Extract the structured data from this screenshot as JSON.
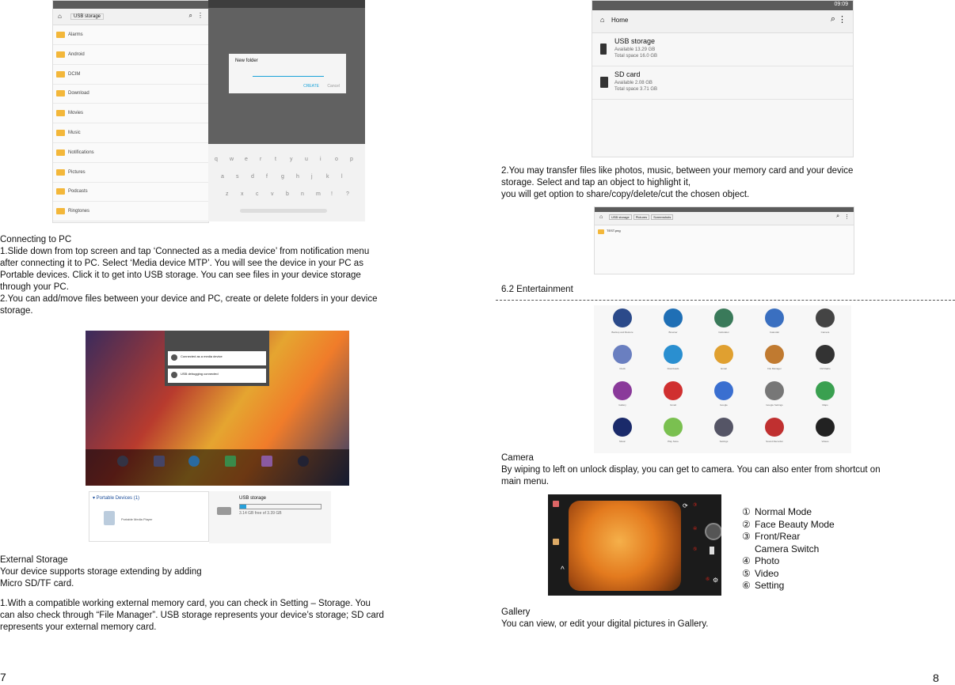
{
  "left": {
    "connecting_title": "Connecting to PC",
    "connecting_body": "1.Slide down from top screen and tap ‘Connected as a media device’ from notification menu\nafter connecting it to PC. Select ‘Media device MTP’. You will see the device in your PC as\nPortable devices. Click it to get into USB storage. You can see files in your device storage\nthrough your PC.\n2.You can add/move files between your device and PC, create or delete folders in your device\nstorage.",
    "external_title": "External Storage",
    "external_body": "Your device supports storage extending by adding\nMicro SD/TF card.",
    "external_body2": "1.With a compatible working external memory card, you can check in Setting – Storage. You\ncan also check through “File Manager”. USB storage represents your device’s storage; SD card\nrepresents your external memory card.",
    "page_number": "7",
    "filemgr": {
      "breadcrumb": "USB storage",
      "folders": [
        "Alarms",
        "Android",
        "DCIM",
        "Download",
        "Movies",
        "Music",
        "Notifications",
        "Pictures",
        "Podcasts",
        "Ringtones"
      ]
    },
    "dialog": {
      "title": "New folder",
      "create": "CREATE",
      "cancel": "Cancel",
      "keys_row1": [
        "q",
        "w",
        "e",
        "r",
        "t",
        "y",
        "u",
        "i",
        "o",
        "p"
      ],
      "keys_row2": [
        "a",
        "s",
        "d",
        "f",
        "g",
        "h",
        "j",
        "k",
        "l"
      ],
      "keys_row3": [
        "z",
        "x",
        "c",
        "v",
        "b",
        "n",
        "m",
        "!",
        "?"
      ]
    },
    "notify": {
      "item1": "Connected as a media device",
      "item2": "USB debugging connected"
    },
    "pc": {
      "portable": "▾ Portable Devices (1)",
      "player": "Portable Media Player",
      "usb": "USB storage",
      "free": "3.14 GB free of 3.39 GB"
    }
  },
  "right": {
    "storage_shot": {
      "home": "Home",
      "usb_title": "USB storage",
      "usb_avail": "Available 13.29 GB",
      "usb_total": "Total space 16.0 GB",
      "sd_title": "SD card",
      "sd_avail": "Available 2.08 GB",
      "sd_total": "Total space 3.71 GB",
      "clock": "09:09"
    },
    "transfer_text": "2.You may transfer files like photos, music,  between your memory card and your device\nstorage. Select and tap an object to highlight it,\nyou will get option to share/copy/delete/cut the chosen object.",
    "path_shot": {
      "crumbs": [
        "USB storage",
        "Pictures",
        "Screenshots"
      ],
      "file": "TEST.png"
    },
    "entertainment_title": "6.2 Entertainment",
    "apps": [
      "Backup and Restore",
      "Browser",
      "Calculator",
      "Calendar",
      "Camera",
      "Clock",
      "Downloads",
      "Email",
      "File Manager",
      "FM Radio",
      "Gallery",
      "Gmail",
      "Google",
      "Google Settings",
      "Maps",
      "Music",
      "Play Store",
      "Settings",
      "Sound Recorder",
      "Videos"
    ],
    "camera_title": "Camera",
    "camera_body": "By wiping to left on unlock display, you can get to camera. You can also enter from shortcut on\nmain menu.",
    "camera_modes": [
      {
        "num": "①",
        "label": "Normal Mode"
      },
      {
        "num": "②",
        "label": "Face Beauty Mode"
      },
      {
        "num": "③",
        "label": "Front/Rear"
      },
      {
        "num": "",
        "label": "Camera Switch"
      },
      {
        "num": "④",
        "label": "Photo"
      },
      {
        "num": "⑤",
        "label": "Video"
      },
      {
        "num": "⑥",
        "label": "Setting"
      }
    ],
    "gallery_title": "Gallery",
    "gallery_body": "You can view, or edit your digital pictures in Gallery.",
    "page_number": "8"
  },
  "colors": {
    "folder": "#f3b73a",
    "statusbar": "#5b5b5b",
    "accent": "#1aa3d9",
    "camera_red": "#e0251b"
  }
}
